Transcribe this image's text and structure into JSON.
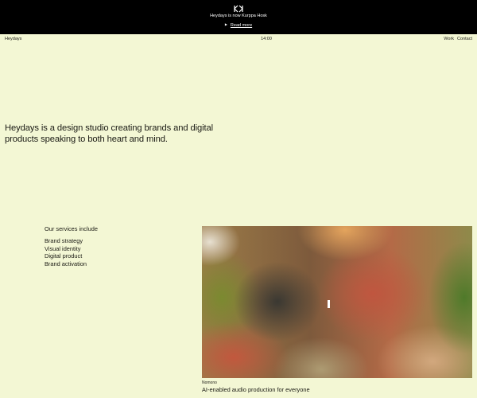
{
  "banner": {
    "logo_icon": "heydays-monogram-icon",
    "announcement": "Heydays is now Kurppa Hosk",
    "read_more": "Read more",
    "arrow_icon": "triangle-right-icon"
  },
  "nav": {
    "brand": "Heydays",
    "clock": "14:00",
    "links": [
      "Work",
      "Contact"
    ]
  },
  "hero": {
    "text": "Heydays is a design studio creating brands and digital products speaking to both heart and mind."
  },
  "services": {
    "heading": "Our services include",
    "items": [
      "Brand strategy",
      "Visual identity",
      "Digital product",
      "Brand activation"
    ]
  },
  "featured_case": {
    "client": "Nomono",
    "description": "AI-enabled audio production for everyone"
  },
  "colors": {
    "background": "#f3f7d4",
    "banner": "#000000",
    "text": "#1a1a14"
  }
}
